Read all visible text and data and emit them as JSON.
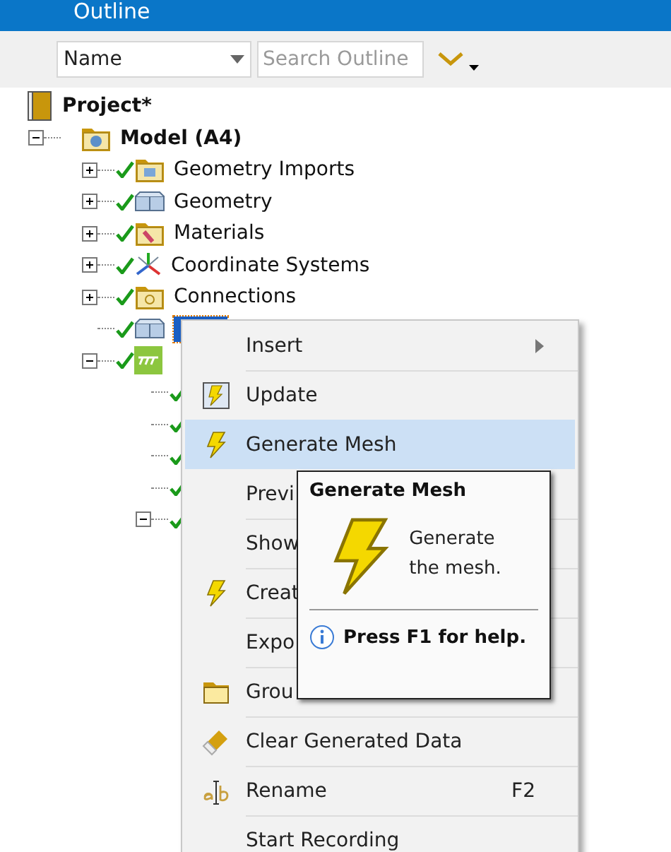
{
  "panel": {
    "title": "Outline"
  },
  "toolbar": {
    "name_combo": {
      "value": "Name"
    },
    "search": {
      "placeholder": "Search Outline"
    }
  },
  "tree": {
    "label": "Project*",
    "kind": "project",
    "children": [
      {
        "label": "Model (A4)",
        "kind": "model",
        "expanded": true,
        "children": [
          {
            "label": "Geometry Imports",
            "kind": "geometry-imports",
            "expanded": false,
            "ok": true
          },
          {
            "label": "Geometry",
            "kind": "geometry",
            "expanded": false,
            "ok": true
          },
          {
            "label": "Materials",
            "kind": "materials",
            "expanded": false,
            "ok": true
          },
          {
            "label": "Coordinate Systems",
            "kind": "coordinates",
            "expanded": false,
            "ok": true
          },
          {
            "label": "Connections",
            "kind": "connections",
            "expanded": false,
            "ok": true
          },
          {
            "kind": "mesh",
            "ok": true,
            "selected": true
          },
          {
            "kind": "study",
            "expanded": true,
            "ok": true,
            "children": [
              {
                "ok": true
              },
              {
                "ok": true
              },
              {
                "ok": true
              },
              {
                "ok": true
              },
              {
                "expanded": true,
                "ok": true
              }
            ]
          }
        ]
      }
    ]
  },
  "context_menu": {
    "items": [
      {
        "label": "Insert",
        "kind": "plain",
        "submenu": true,
        "selected": false
      },
      {
        "label": "Update",
        "kind": "update",
        "selected": false
      },
      {
        "label": "Generate Mesh",
        "kind": "generate",
        "selected": true
      },
      {
        "label": "Previ",
        "kind": "plain",
        "selected": false
      },
      {
        "label": "Show",
        "kind": "plain",
        "selected": false
      },
      {
        "label": "Creat",
        "kind": "generate",
        "selected": false
      },
      {
        "label": "Expo",
        "kind": "plain",
        "selected": false
      },
      {
        "label": "Grou",
        "kind": "group",
        "selected": false
      },
      {
        "label": "Clear Generated Data",
        "kind": "clear",
        "selected": false
      },
      {
        "label": "Rename",
        "kind": "rename",
        "shortcut": "F2",
        "selected": false
      },
      {
        "label": "Start Recording",
        "kind": "plain",
        "selected": false
      }
    ]
  },
  "tooltip": {
    "title": "Generate Mesh",
    "body": "Generate the mesh.",
    "help": "Press F1 for help."
  }
}
